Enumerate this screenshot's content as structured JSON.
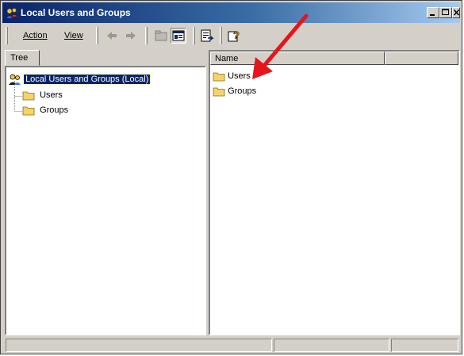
{
  "window": {
    "title": "Local Users and Groups"
  },
  "menu": {
    "action": "Action",
    "view": "View"
  },
  "left_pane": {
    "tab_label": "Tree",
    "root_label": "Local Users and Groups (Local)",
    "children": [
      "Users",
      "Groups"
    ]
  },
  "right_pane": {
    "columns": [
      "Name",
      ""
    ],
    "items": [
      "Users",
      "Groups"
    ]
  },
  "colors": {
    "titlebar_start": "#0a246a",
    "titlebar_end": "#a6caf0",
    "annotation_arrow": "#e8141b",
    "folder": "#f5d36b"
  },
  "icons": [
    "snapin-icon",
    "minimize-icon",
    "maximize-icon",
    "close-icon",
    "back-arrow-icon",
    "forward-arrow-icon",
    "up-folder-icon",
    "show-hide-tree-icon",
    "export-list-icon",
    "help-icon",
    "folder-icon"
  ]
}
